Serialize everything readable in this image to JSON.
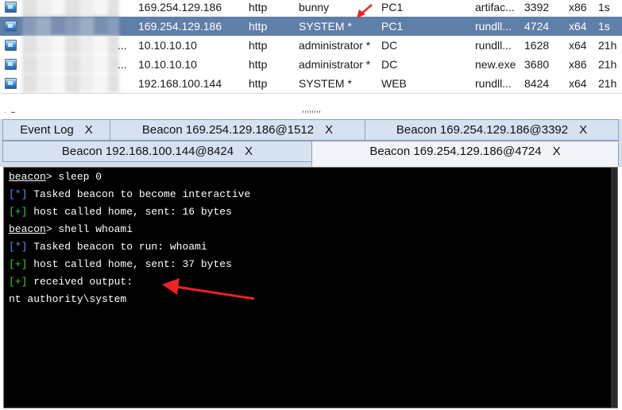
{
  "sessions": [
    {
      "ext": "",
      "internal": "169.254.129.186",
      "listener": "http",
      "user": "bunny",
      "computer": "PC1",
      "process": "artifac...",
      "pid": "3392",
      "arch": "x86",
      "last": "1s",
      "selected": false
    },
    {
      "ext": "",
      "internal": "169.254.129.186",
      "listener": "http",
      "user": "SYSTEM *",
      "computer": "PC1",
      "process": "rundll...",
      "pid": "4724",
      "arch": "x64",
      "last": "1s",
      "selected": true
    },
    {
      "ext": "...",
      "internal": "10.10.10.10",
      "listener": "http",
      "user": "administrator *",
      "computer": "DC",
      "process": "rundll...",
      "pid": "1628",
      "arch": "x64",
      "last": "21h",
      "selected": false
    },
    {
      "ext": "...",
      "internal": "10.10.10.10",
      "listener": "http",
      "user": "administrator *",
      "computer": "DC",
      "process": "new.exe",
      "pid": "3680",
      "arch": "x86",
      "last": "21h",
      "selected": false
    },
    {
      "ext": "",
      "internal": "192.168.100.144",
      "listener": "http",
      "user": "SYSTEM *",
      "computer": "WEB",
      "process": "rundll...",
      "pid": "8424",
      "arch": "x64",
      "last": "21h",
      "selected": false
    }
  ],
  "tabs": {
    "row1": [
      {
        "label": "Event Log",
        "close": "X"
      },
      {
        "label": "Beacon 169.254.129.186@1512",
        "close": "X"
      },
      {
        "label": "Beacon 169.254.129.186@3392",
        "close": "X"
      }
    ],
    "row2": [
      {
        "label": "Beacon 192.168.100.144@8424",
        "close": "X"
      },
      {
        "label": "Beacon 169.254.129.186@4724",
        "close": "X"
      }
    ]
  },
  "console": {
    "lines": [
      {
        "prompt": "beacon",
        "text": "> sleep 0"
      },
      {
        "tag": "[*]",
        "text": " Tasked beacon to become interactive"
      },
      {
        "tag": "[+]",
        "text": " host called home, sent: 16 bytes"
      },
      {
        "prompt": "beacon",
        "text": "> shell whoami"
      },
      {
        "tag": "[*]",
        "text": " Tasked beacon to run: whoami"
      },
      {
        "tag": "[+]",
        "text": " host called home, sent: 37 bytes"
      },
      {
        "tag": "[+]",
        "text": " received output:"
      },
      {
        "text": "nt authority\\system"
      }
    ]
  },
  "colors": {
    "selected_row": "#5f7ea8",
    "info_tag": "#5a8cff",
    "ok_tag": "#35d035",
    "annotation_arrow": "#ee2222"
  }
}
